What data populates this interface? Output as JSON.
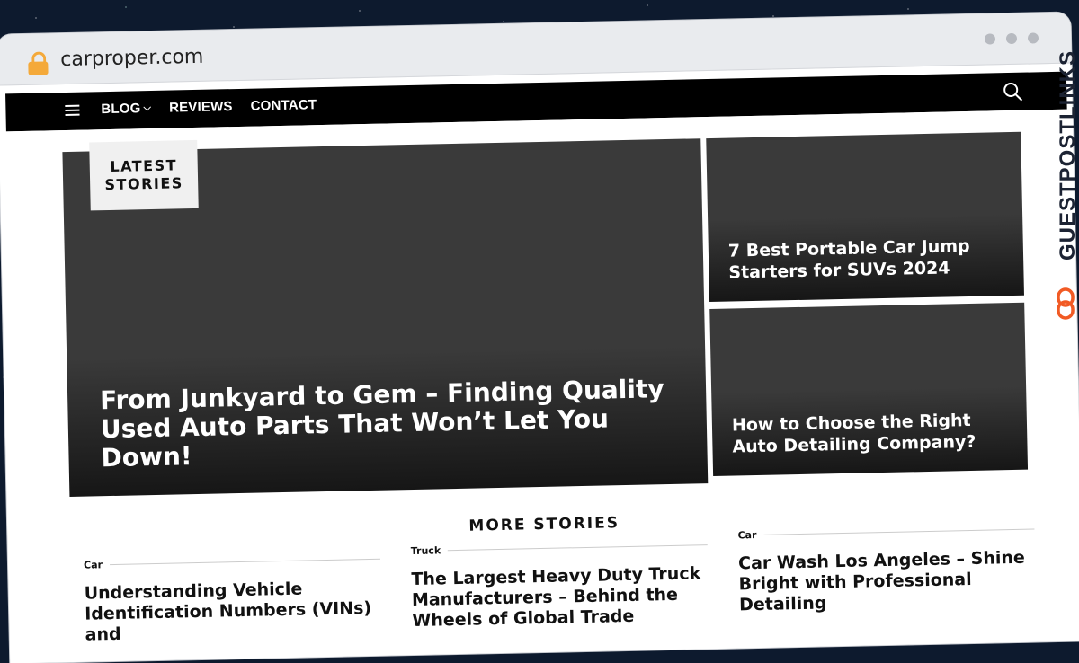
{
  "browser": {
    "url": "carproper.com"
  },
  "nav": {
    "items": [
      {
        "label": "BLOG",
        "has_dropdown": true
      },
      {
        "label": "REVIEWS",
        "has_dropdown": false
      },
      {
        "label": "CONTACT",
        "has_dropdown": false
      }
    ]
  },
  "hero": {
    "badge_line1": "LATEST",
    "badge_line2": "STORIES",
    "title": "From Junkyard to Gem – Finding Quality Used Auto Parts That Won’t Let You Down!"
  },
  "side_stories": [
    {
      "title": "7 Best Portable Car Jump Starters for SUVs 2024"
    },
    {
      "title": "How to Choose the Right Auto Detailing Company?"
    }
  ],
  "more_stories": {
    "heading": "MORE STORIES",
    "items": [
      {
        "category": "Car",
        "title": "Understanding Vehicle Identification Numbers (VINs) and"
      },
      {
        "category": "Truck",
        "title": "The Largest Heavy Duty Truck Manufacturers – Behind the Wheels of Global Trade"
      },
      {
        "category": "Car",
        "title": "Car Wash Los Angeles – Shine Bright with Professional Detailing"
      }
    ]
  },
  "watermark": {
    "text": "GUESTPOSTLINKS"
  },
  "colors": {
    "nav_bg": "#000000",
    "card_bg": "#3a3a3a",
    "lock": "#f4a93a",
    "watermark_accent": "#f15a24"
  }
}
